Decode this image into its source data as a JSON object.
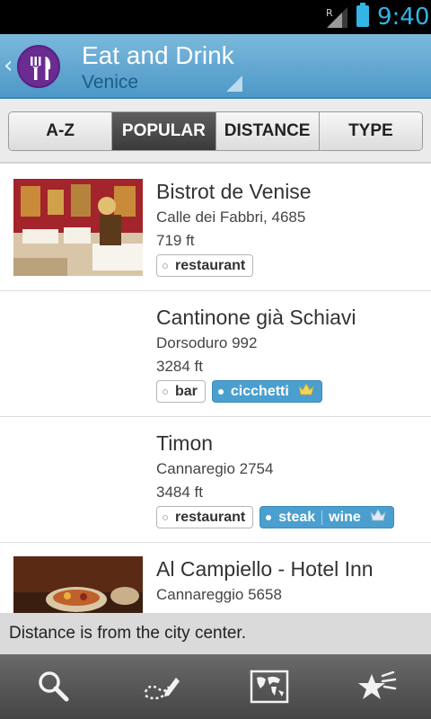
{
  "status_bar": {
    "time": "9:40",
    "signal_letter": "R"
  },
  "header": {
    "title": "Eat and Drink",
    "subtitle": "Venice",
    "icon": "fork-knife-icon"
  },
  "tabs": [
    {
      "label": "A-Z",
      "active": false
    },
    {
      "label": "POPULAR",
      "active": true
    },
    {
      "label": "DISTANCE",
      "active": false
    },
    {
      "label": "TYPE",
      "active": false
    }
  ],
  "places": [
    {
      "name": "Bistrot de Venise",
      "address": "Calle dei Fabbri, 4685",
      "distance": "719 ft",
      "tags": [
        {
          "text": "restaurant",
          "style": "plain"
        }
      ],
      "has_photo": true
    },
    {
      "name": "Cantinone già Schiavi",
      "address": "Dorsoduro 992",
      "distance": "3284 ft",
      "tags": [
        {
          "text": "bar",
          "style": "plain"
        },
        {
          "text": "cicchetti",
          "style": "blue",
          "crown": true
        }
      ],
      "has_photo": false
    },
    {
      "name": "Timon",
      "address": "Cannaregio 2754",
      "distance": "3484 ft",
      "tags": [
        {
          "text": "restaurant",
          "style": "plain"
        },
        {
          "text": "steak",
          "text2": "wine",
          "style": "blue",
          "crown": true
        }
      ],
      "has_photo": false
    },
    {
      "name": "Al Campiello - Hotel Inn",
      "address": "Cannareggio 5658",
      "distance": "",
      "tags": [],
      "has_photo": true
    }
  ],
  "note": "Distance is from the city center.",
  "bottom_bar": {
    "icons": [
      "search-icon",
      "draw-route-icon",
      "world-map-icon",
      "favorites-star-icon"
    ]
  },
  "colors": {
    "accent": "#33b5e5",
    "header": "#5aa3d0",
    "brand_purple": "#6a2c91",
    "tag_blue": "#4a9fcf"
  }
}
